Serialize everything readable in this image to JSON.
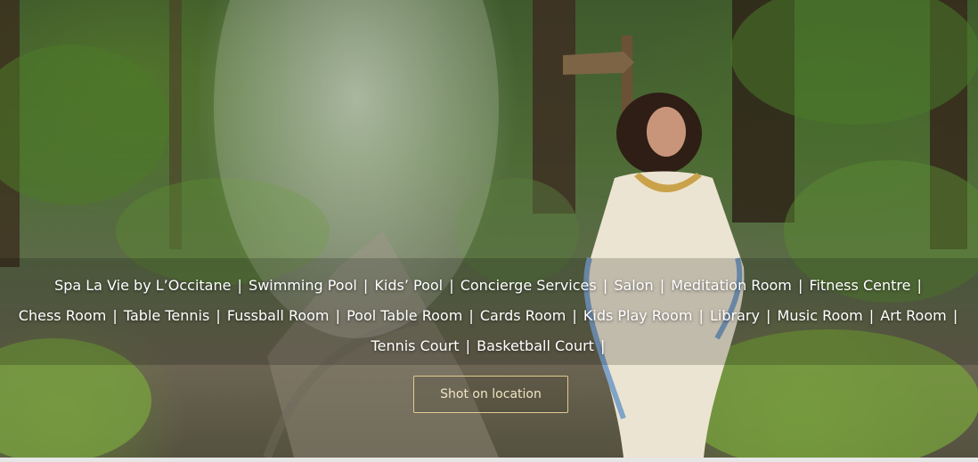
{
  "hero": {
    "image": "woman-walking-forest-path-photo",
    "amenities": [
      "Spa La Vie by L’Occitane",
      "Swimming Pool",
      "Kids’ Pool",
      "Concierge Services",
      "Salon",
      "Meditation Room",
      "Fitness Centre",
      "Chess Room",
      "Table Tennis",
      "Fussball Room",
      "Pool Table Room",
      "Cards Room",
      "Kids Play Room",
      "Library",
      "Music Room",
      "Art Room",
      "Tennis Court",
      "Basketball Court"
    ],
    "separator": "|",
    "cta_label": "Shot on location"
  },
  "colors": {
    "text": "#ffffff",
    "cta_border": "#e2c98f",
    "cta_text": "#f1e4c4"
  }
}
